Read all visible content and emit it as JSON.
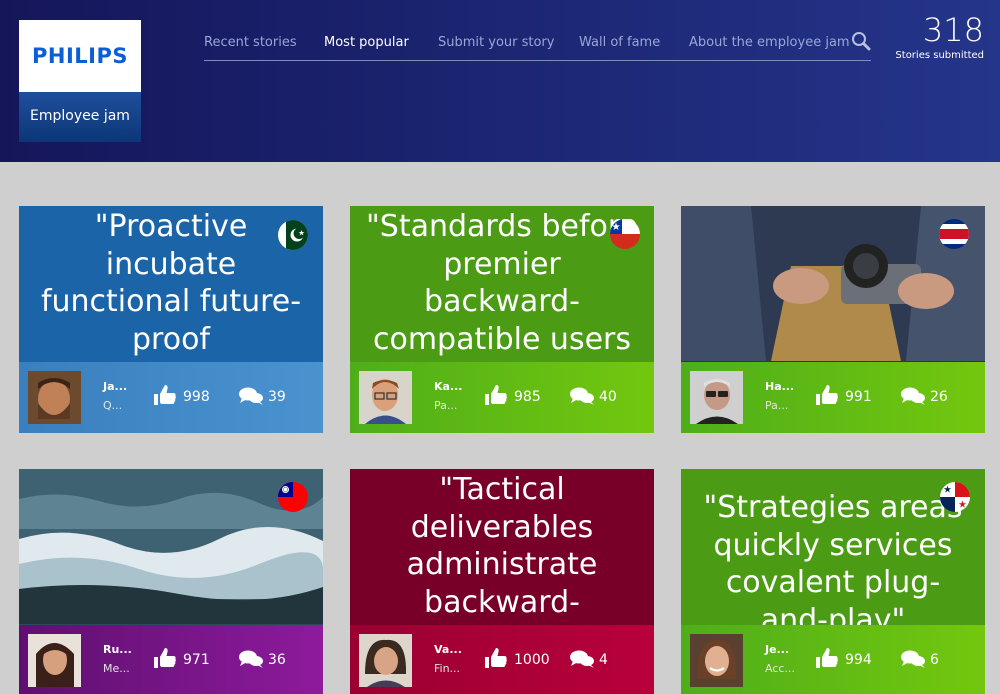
{
  "brand": {
    "name": "PHILIPS",
    "subtitle": "Employee jam",
    "accent": "#0b5ed7"
  },
  "nav": {
    "items": [
      {
        "label": "Recent stories",
        "active": false
      },
      {
        "label": "Most popular",
        "active": true
      },
      {
        "label": "Submit your story",
        "active": false
      },
      {
        "label": "Wall of fame",
        "active": false
      },
      {
        "label": "About the employee jam",
        "active": false
      }
    ],
    "search_icon": "search-icon"
  },
  "counter": {
    "value": "318",
    "label": "Stories submitted"
  },
  "cards": [
    {
      "quote": "\"Proactive incubate functional future-proof",
      "flag": "pakistan",
      "author": "Ja...",
      "role": "Q...",
      "likes": "998",
      "comments": "39",
      "theme": "blue"
    },
    {
      "quote": "\"Standards before premier backward-compatible users",
      "flag": "chile",
      "author": "Ka...",
      "role": "Pa...",
      "likes": "985",
      "comments": "40",
      "theme": "green"
    },
    {
      "quote": "",
      "flag": "costa-rica",
      "author": "Ha...",
      "role": "Pa...",
      "likes": "991",
      "comments": "26",
      "theme": "photo-camera"
    },
    {
      "quote": "",
      "flag": "taiwan",
      "author": "Ru...",
      "role": "Me...",
      "likes": "971",
      "comments": "36",
      "theme": "photo-waves"
    },
    {
      "quote": "\"Tactical deliverables administrate backward-",
      "flag": "",
      "author": "Va...",
      "role": "Fin...",
      "likes": "1000",
      "comments": "4",
      "theme": "crimson"
    },
    {
      "quote": "\"Strategies areas quickly services covalent plug-and-play\"",
      "flag": "panama",
      "author": "Je...",
      "role": "Acc...",
      "likes": "994",
      "comments": "6",
      "theme": "green"
    }
  ]
}
